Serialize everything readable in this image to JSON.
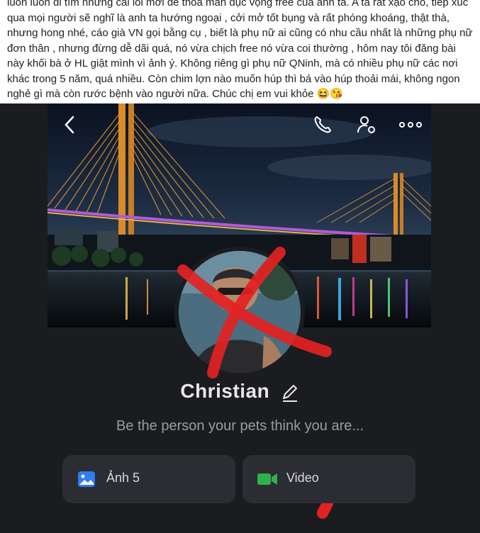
{
  "post": {
    "text": "luôn luôn đi tìm những cái lồi mới để thỏa mãn dục vọng free của anh ta. A ta rất xạo chó, tiếp xúc qua mọi người sẽ nghĩ là anh ta hướng ngoại , cởi mở tốt bụng  và rất phóng khoáng, thật thà, nhưng hong nhé, cáo già VN gọi bằng cụ , biết là phụ nữ ai cũng có nhu cầu nhất là những phụ nữ đơn thân , nhưng đừng dễ dãi quá, nó vừa chịch free nó vừa coi thường , hôm nay tôi đăng bài này khối bà ở HL giật mình vì ảnh ý. Không riêng gì phụ nữ QNinh, mà có nhiều phụ nữ các nơi khác trong 5 năm, quá nhiều. Còn chim lợn nào muốn húp thì bá vào húp thoải mái, không ngon nghẻ gì mà còn rước bệnh vào người nữa. Chúc chị em vui khỏe 😆😘"
  },
  "profile": {
    "name": "Christian",
    "bio": "Be the person your pets think you are..."
  },
  "buttons": {
    "photos_label": "Ảnh 5",
    "videos_label": "Video"
  },
  "colors": {
    "photos_icon": "#2f7cf6",
    "videos_icon": "#2fb24c",
    "scribble": "#e32222"
  },
  "icons": [
    "back-icon",
    "phone-icon",
    "user-settings-icon",
    "more-icon",
    "edit-pencil-icon",
    "photo-icon",
    "video-camera-icon"
  ]
}
